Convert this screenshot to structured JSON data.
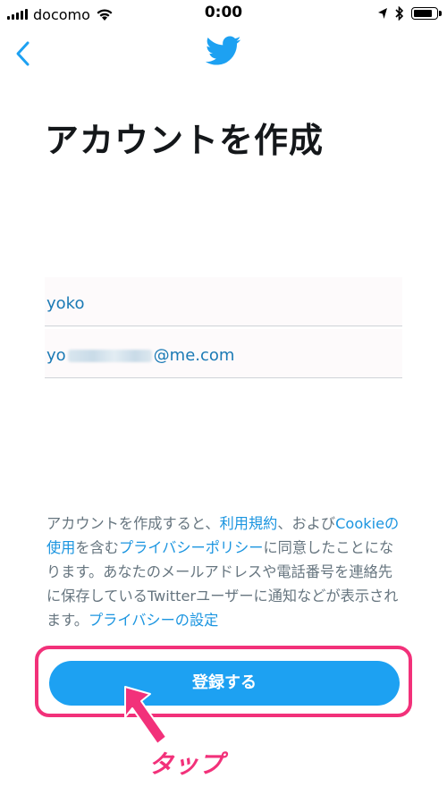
{
  "status_bar": {
    "carrier": "docomo",
    "time": "0:00",
    "icons": [
      "signal-bars-icon",
      "wifi-icon",
      "location-arrow-icon",
      "bluetooth-icon",
      "battery-icon"
    ],
    "battery_level": 0.85
  },
  "nav": {
    "back_icon": "chevron-left-icon",
    "logo_icon": "twitter-bird-icon",
    "accent_color": "#1da1f2"
  },
  "page": {
    "title": "アカウントを作成"
  },
  "form": {
    "name_value": "yoko",
    "email_prefix": "yo",
    "email_suffix": "@me.com"
  },
  "terms": {
    "part1": "アカウントを作成すると、",
    "link_terms": "利用規約",
    "part2": "、および",
    "link_cookie": "Cookieの使用",
    "part3": "を含む",
    "link_privacy": "プライバシーポリシー",
    "part4": "に同意したことになります。あなたのメールアドレスや電話番号を連絡先に保存しているTwitterユーザーに通知などが表示されます。",
    "link_privacy_settings": "プライバシーの設定"
  },
  "signup_button": {
    "label": "登録する"
  },
  "annotation": {
    "label": "タップ",
    "color": "#f2317a"
  }
}
